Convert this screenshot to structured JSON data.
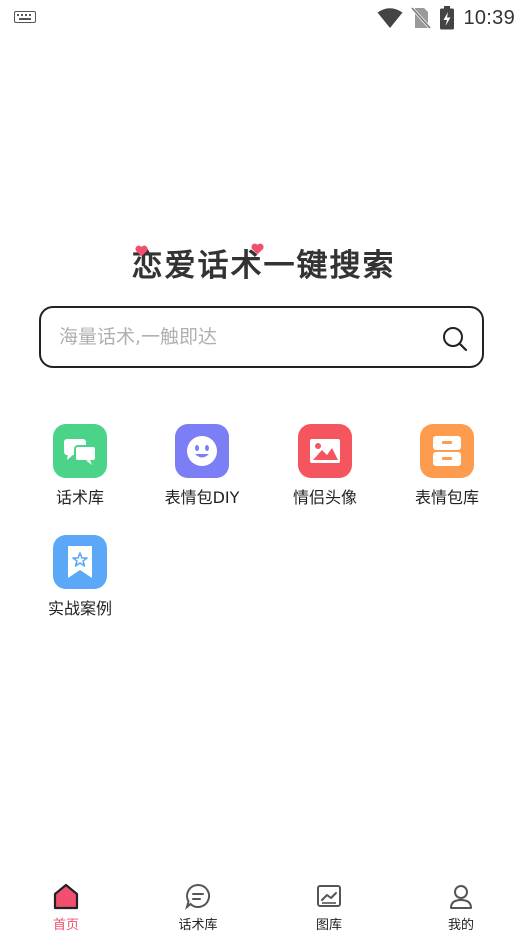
{
  "status_bar": {
    "time": "10:39"
  },
  "slogan": "恋爱话术一键搜索",
  "search": {
    "placeholder": "海量话术,一触即达"
  },
  "features": [
    {
      "label": "话术库",
      "icon": "chat-bubbles-icon",
      "color": "#4cd38a"
    },
    {
      "label": "表情包DIY",
      "icon": "smiley-face-icon",
      "color": "#7b7ef5"
    },
    {
      "label": "情侣头像",
      "icon": "picture-icon",
      "color": "#f4555f"
    },
    {
      "label": "表情包库",
      "icon": "drawers-icon",
      "color": "#fd9c4f"
    },
    {
      "label": "实战案例",
      "icon": "bookmark-star-icon",
      "color": "#5aa8f7"
    }
  ],
  "bottom_nav": [
    {
      "label": "首页",
      "icon": "home-icon",
      "active": true
    },
    {
      "label": "话术库",
      "icon": "chat-icon",
      "active": false
    },
    {
      "label": "图库",
      "icon": "gallery-icon",
      "active": false
    },
    {
      "label": "我的",
      "icon": "profile-icon",
      "active": false
    }
  ],
  "colors": {
    "accent": "#f0506e",
    "text": "#222222",
    "placeholder": "#b0b0b0"
  }
}
